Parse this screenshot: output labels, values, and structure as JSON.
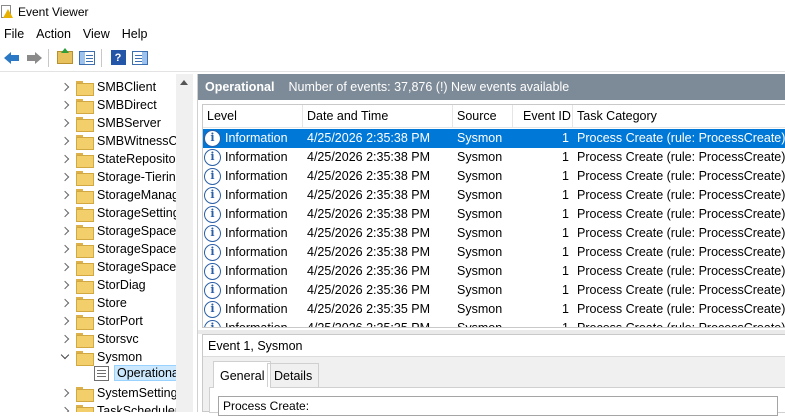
{
  "window": {
    "title": "Event Viewer"
  },
  "menu": [
    "File",
    "Action",
    "View",
    "Help"
  ],
  "toolbar": {
    "icons": [
      "back-arrow-icon",
      "forward-arrow-icon",
      "folder-up-icon",
      "show-hide-tree-icon",
      "help-icon",
      "show-hide-action-pane-icon"
    ]
  },
  "tree": {
    "items": [
      {
        "label": "SMBClient",
        "expanded": false
      },
      {
        "label": "SMBDirect",
        "expanded": false
      },
      {
        "label": "SMBServer",
        "expanded": false
      },
      {
        "label": "SMBWitnessCli",
        "expanded": false
      },
      {
        "label": "StateRepository",
        "expanded": false
      },
      {
        "label": "Storage-Tiering",
        "expanded": false
      },
      {
        "label": "StorageManag",
        "expanded": false
      },
      {
        "label": "StorageSetting",
        "expanded": false
      },
      {
        "label": "StorageSpaces-",
        "expanded": false
      },
      {
        "label": "StorageSpaces-",
        "expanded": false
      },
      {
        "label": "StorageSpaces-",
        "expanded": false
      },
      {
        "label": "StorDiag",
        "expanded": false
      },
      {
        "label": "Store",
        "expanded": false
      },
      {
        "label": "StorPort",
        "expanded": false
      },
      {
        "label": "Storsvc",
        "expanded": false
      },
      {
        "label": "Sysmon",
        "expanded": true
      },
      {
        "label": "Operational",
        "log": true,
        "selected": true
      },
      {
        "label": "SystemSettings",
        "expanded": false
      },
      {
        "label": "TaskScheduler",
        "expanded": false
      }
    ]
  },
  "pane": {
    "title": "Operational",
    "info": "Number of events: 37,876 (!) New events available"
  },
  "grid": {
    "columns": [
      "Level",
      "Date and Time",
      "Source",
      "Event ID",
      "Task Category"
    ],
    "rows": [
      [
        "Information",
        "4/25/2026 2:35:38 PM",
        "Sysmon",
        "1",
        "Process Create (rule: ProcessCreate)"
      ],
      [
        "Information",
        "4/25/2026 2:35:38 PM",
        "Sysmon",
        "1",
        "Process Create (rule: ProcessCreate)"
      ],
      [
        "Information",
        "4/25/2026 2:35:38 PM",
        "Sysmon",
        "1",
        "Process Create (rule: ProcessCreate)"
      ],
      [
        "Information",
        "4/25/2026 2:35:38 PM",
        "Sysmon",
        "1",
        "Process Create (rule: ProcessCreate)"
      ],
      [
        "Information",
        "4/25/2026 2:35:38 PM",
        "Sysmon",
        "1",
        "Process Create (rule: ProcessCreate)"
      ],
      [
        "Information",
        "4/25/2026 2:35:38 PM",
        "Sysmon",
        "1",
        "Process Create (rule: ProcessCreate)"
      ],
      [
        "Information",
        "4/25/2026 2:35:38 PM",
        "Sysmon",
        "1",
        "Process Create (rule: ProcessCreate)"
      ],
      [
        "Information",
        "4/25/2026 2:35:36 PM",
        "Sysmon",
        "1",
        "Process Create (rule: ProcessCreate)"
      ],
      [
        "Information",
        "4/25/2026 2:35:36 PM",
        "Sysmon",
        "1",
        "Process Create (rule: ProcessCreate)"
      ],
      [
        "Information",
        "4/25/2026 2:35:35 PM",
        "Sysmon",
        "1",
        "Process Create (rule: ProcessCreate)"
      ],
      [
        "Information",
        "4/25/2026 2:35:35 PM",
        "Sysmon",
        "1",
        "Process Create (rule: ProcessCreate)"
      ]
    ],
    "selected_row": 0
  },
  "detail": {
    "title": "Event 1, Sysmon",
    "tabs": [
      "General",
      "Details"
    ],
    "active_tab": "General",
    "text": "Process Create:"
  },
  "colors": {
    "header_bg": "#7d8a97",
    "selection": "#0078d7",
    "tree_selection": "#cce8ff"
  }
}
